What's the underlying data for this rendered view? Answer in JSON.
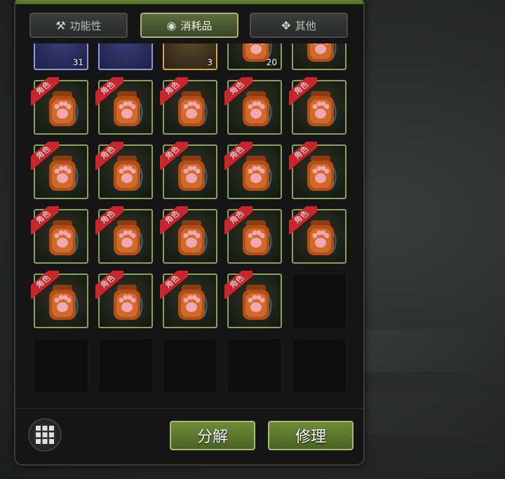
{
  "tabs": [
    {
      "label": "功能性",
      "icon": "hammer-icon"
    },
    {
      "label": "消耗品",
      "icon": "potion-icon"
    },
    {
      "label": "其他",
      "icon": "misc-icon"
    }
  ],
  "active_tab": "消耗品",
  "item_badge": "角色",
  "partial_row_counts": [
    "31",
    "",
    "3",
    "20",
    ""
  ],
  "actions": {
    "decompose": "分解",
    "repair": "修理"
  },
  "colors": {
    "accent": "#6f8a38",
    "badge": "#c9252c",
    "uncommon_border": "#8aa15a",
    "rare_border": "#8e98e6",
    "legendary_border": "#d7a545"
  }
}
